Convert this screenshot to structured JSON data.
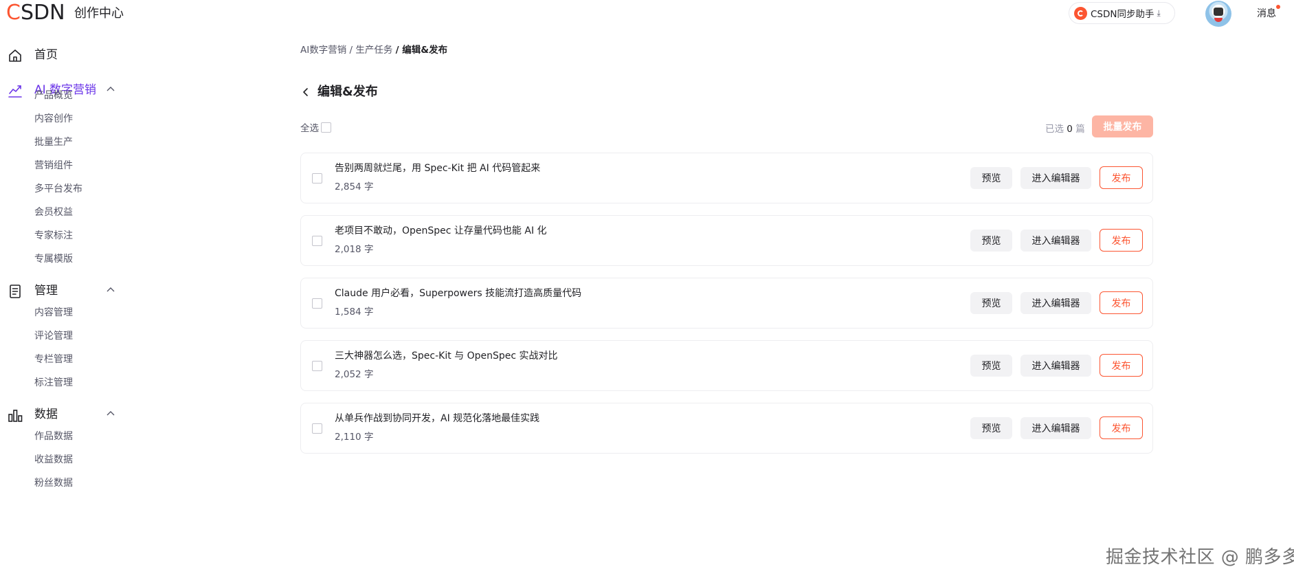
{
  "header": {
    "logo_c": "C",
    "logo_rest": "SDN",
    "title": "创作中心",
    "sync_button": "CSDN同步助手",
    "sync_download_glyph": "⤓",
    "messages": "消息",
    "has_unread": true
  },
  "sidebar": {
    "home": {
      "label": "首页",
      "icon": "home-icon"
    },
    "groups": [
      {
        "label": "AI 数字营销",
        "icon": "trend-icon",
        "active": true,
        "expanded": true,
        "items": [
          "产品概览",
          "内容创作",
          "批量生产",
          "营销组件",
          "多平台发布",
          "会员权益",
          "专家标注",
          "专属模版"
        ]
      },
      {
        "label": "管理",
        "icon": "document-icon",
        "expanded": true,
        "items": [
          "内容管理",
          "评论管理",
          "专栏管理",
          "标注管理"
        ]
      },
      {
        "label": "数据",
        "icon": "bar-chart-icon",
        "expanded": true,
        "items": [
          "作品数据",
          "收益数据",
          "粉丝数据"
        ]
      }
    ]
  },
  "breadcrumb": {
    "items": [
      "AI数字营销",
      "生产任务"
    ],
    "separator": "/",
    "current": "/ 编辑&发布"
  },
  "page": {
    "title": "编辑&发布",
    "select_all": "全选",
    "selected_prefix": "已选",
    "selected_count": "0",
    "selected_suffix": "篇",
    "batch_publish": "批量发布"
  },
  "articles": [
    {
      "title": "告别两周就烂尾，用 Spec-Kit 把 AI 代码管起来",
      "count": "2,854 字"
    },
    {
      "title": "老项目不敢动，OpenSpec 让存量代码也能 AI 化",
      "count": "2,018 字"
    },
    {
      "title": "Claude 用户必看，Superpowers 技能流打造高质量代码",
      "count": "1,584 字"
    },
    {
      "title": "三大神器怎么选，Spec-Kit 与 OpenSpec 实战对比",
      "count": "2,052 字"
    },
    {
      "title": "从单兵作战到协同开发，AI 规范化落地最佳实践",
      "count": "2,110 字"
    }
  ],
  "article_actions": {
    "preview": "预览",
    "editor": "进入编辑器",
    "publish": "发布"
  },
  "watermark": "掘金技术社区 @ 鹏多多",
  "colors": {
    "brand": "#fc5531",
    "accent": "#6b35e8",
    "batch_disabled": "#fdb5a4"
  }
}
